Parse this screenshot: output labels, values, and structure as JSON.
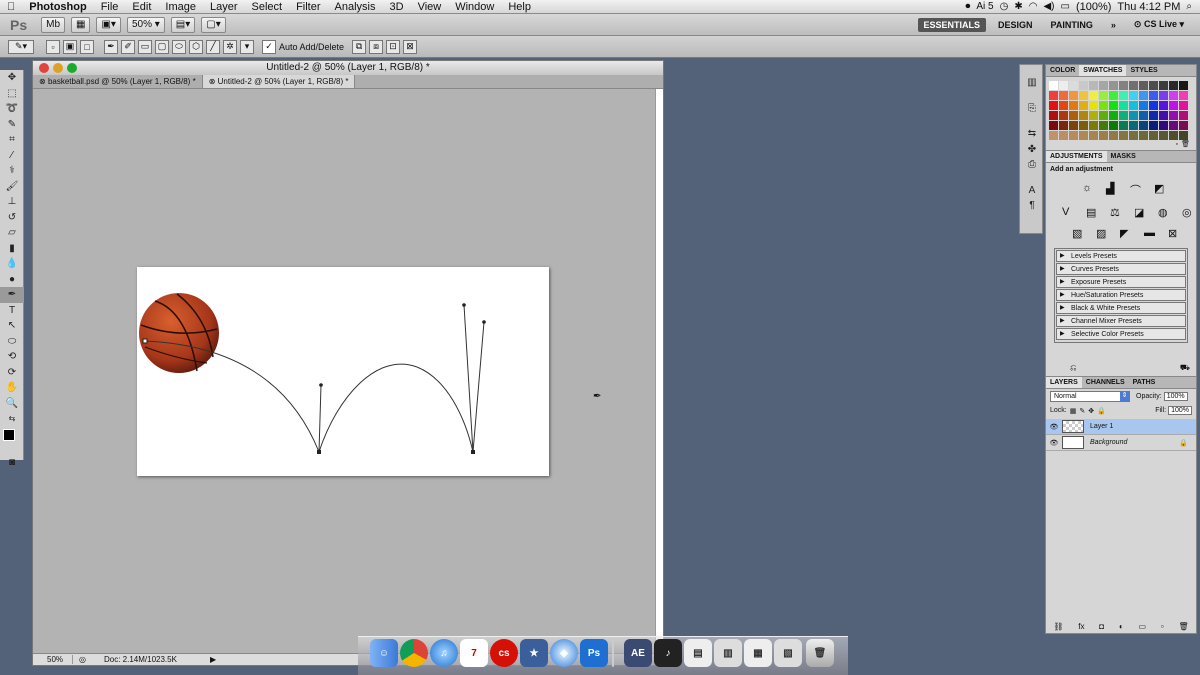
{
  "menubar": {
    "app": "Photoshop",
    "items": [
      "File",
      "Edit",
      "Image",
      "Layer",
      "Select",
      "Filter",
      "Analysis",
      "3D",
      "View",
      "Window",
      "Help"
    ],
    "battery": "(100%)",
    "clock": "Thu 4:12 PM",
    "ai_badge": "5"
  },
  "appbar": {
    "logo": "Ps",
    "mb": "Mb",
    "zoom": "50%",
    "workspaces": [
      "ESSENTIALS",
      "DESIGN",
      "PAINTING"
    ],
    "more": "»",
    "cs_live": "CS Live"
  },
  "optbar": {
    "auto_add_delete": "Auto Add/Delete"
  },
  "document": {
    "title": "Untitled-2 @ 50% (Layer 1, RGB/8) *",
    "tabs": [
      "basketball.psd @ 50% (Layer 1, RGB/8) *",
      "Untitled-2 @ 50% (Layer 1, RGB/8) *"
    ],
    "status_zoom": "50%",
    "status_doc": "Doc: 2.14M/1023.5K"
  },
  "color_panel": {
    "tabs": [
      "COLOR",
      "SWATCHES",
      "STYLES"
    ],
    "active": "SWATCHES"
  },
  "adjustments_panel": {
    "tabs": [
      "ADJUSTMENTS",
      "MASKS"
    ],
    "subtitle": "Add an adjustment",
    "presets": [
      "Levels Presets",
      "Curves Presets",
      "Exposure Presets",
      "Hue/Saturation Presets",
      "Black & White Presets",
      "Channel Mixer Presets",
      "Selective Color Presets"
    ]
  },
  "layers_panel": {
    "tabs": [
      "LAYERS",
      "CHANNELS",
      "PATHS"
    ],
    "blend_mode": "Normal",
    "opacity_label": "Opacity:",
    "opacity_value": "100%",
    "lock_label": "Lock:",
    "fill_label": "Fill:",
    "fill_value": "100%",
    "layers": [
      "Layer 1",
      "Background"
    ]
  },
  "dock": {
    "ps_label": "Ps",
    "ae_label": "AE",
    "cal_day": "7"
  },
  "colors": {
    "accent_blue": "#a9c7ee",
    "ps_blue": "#1e6fd1",
    "basketball": "#b5401e"
  }
}
